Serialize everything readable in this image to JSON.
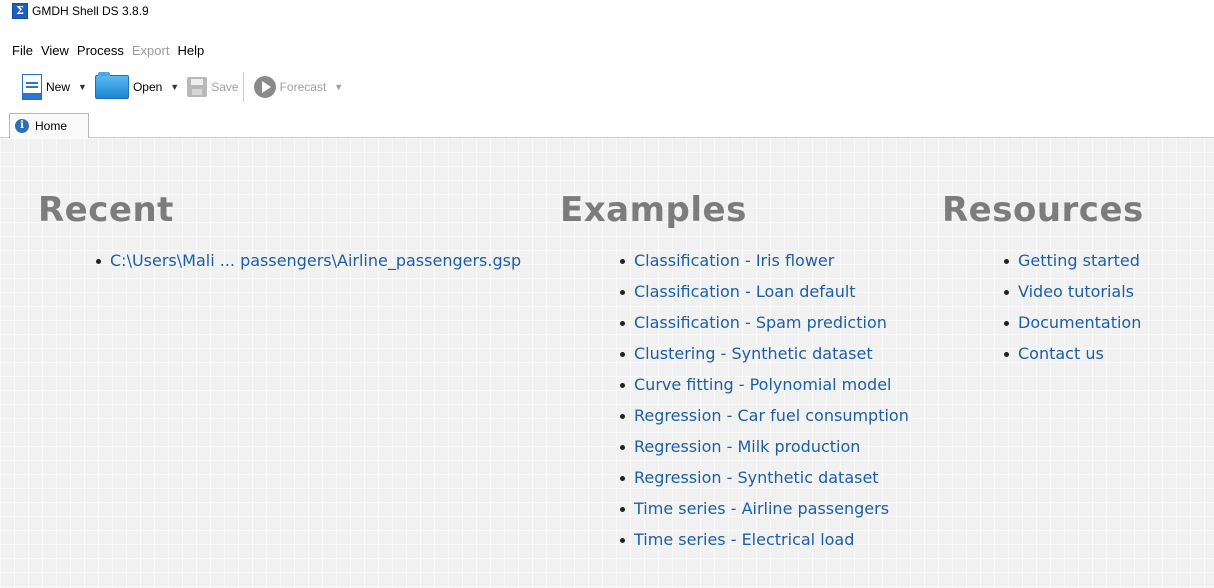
{
  "window": {
    "title": "GMDH Shell DS 3.8.9"
  },
  "menu": {
    "items": [
      {
        "label": "File",
        "enabled": true
      },
      {
        "label": "View",
        "enabled": true
      },
      {
        "label": "Process",
        "enabled": true
      },
      {
        "label": "Export",
        "enabled": false
      },
      {
        "label": "Help",
        "enabled": true
      }
    ]
  },
  "toolbar": {
    "new_label": "New",
    "open_label": "Open",
    "save_label": "Save",
    "forecast_label": "Forecast"
  },
  "tabs": [
    {
      "label": "Home",
      "active": true
    }
  ],
  "home": {
    "recent": {
      "heading": "Recent",
      "items": [
        "C:\\Users\\Mali ... passengers\\Airline_passengers.gsp"
      ]
    },
    "examples": {
      "heading": "Examples",
      "items": [
        "Classification - Iris flower",
        "Classification - Loan default",
        "Classification - Spam prediction",
        "Clustering - Synthetic dataset",
        "Curve fitting - Polynomial model",
        "Regression - Car fuel consumption",
        "Regression - Milk production",
        "Regression - Synthetic dataset",
        "Time series - Airline passengers",
        "Time series - Electrical load"
      ]
    },
    "resources": {
      "heading": "Resources",
      "items": [
        "Getting started",
        "Video tutorials",
        "Documentation",
        "Contact us"
      ]
    }
  },
  "colors": {
    "link": "#1c5fa6",
    "heading": "#7c7c7c",
    "disabled": "#9a9a9a",
    "background": "#f1f1f1"
  },
  "icons": {
    "app": "sigma-icon",
    "new": "new-document-icon",
    "open": "folder-icon",
    "save": "floppy-disk-icon",
    "forecast": "play-icon",
    "home_tab": "info-icon"
  }
}
